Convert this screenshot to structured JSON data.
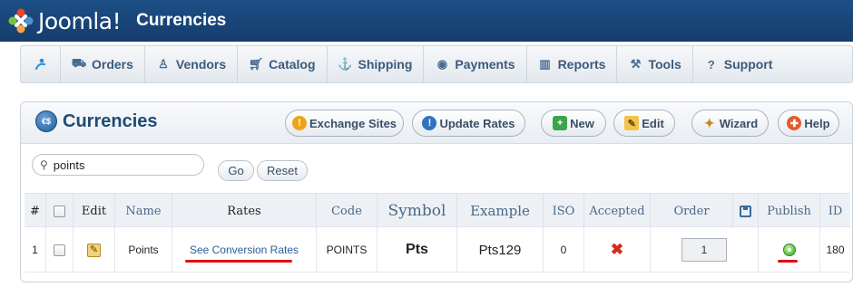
{
  "header": {
    "logo_text": "Joomla!",
    "title": "Currencies"
  },
  "menu": {
    "items": [
      {
        "label": "Orders",
        "icon": "truck-icon"
      },
      {
        "label": "Vendors",
        "icon": "person-icon"
      },
      {
        "label": "Catalog",
        "icon": "cart-icon"
      },
      {
        "label": "Shipping",
        "icon": "ship-icon"
      },
      {
        "label": "Payments",
        "icon": "coin-icon"
      },
      {
        "label": "Reports",
        "icon": "chart-icon"
      },
      {
        "label": "Tools",
        "icon": "tools-icon"
      },
      {
        "label": "Support",
        "icon": "question-icon"
      }
    ]
  },
  "toolbar": {
    "title": "Currencies",
    "title_icon_text": "€$",
    "exchange_sites": "Exchange Sites",
    "update_rates": "Update Rates",
    "new": "New",
    "edit": "Edit",
    "wizard": "Wizard",
    "help": "Help"
  },
  "filter": {
    "search_value": "points",
    "go": "Go",
    "reset": "Reset"
  },
  "table": {
    "headers": {
      "num": "#",
      "edit": "Edit",
      "name": "Name",
      "rates": "Rates",
      "code": "Code",
      "symbol": "Symbol",
      "example": "Example",
      "iso": "ISO",
      "accepted": "Accepted",
      "order": "Order",
      "publish": "Publish",
      "id": "ID"
    },
    "rows": [
      {
        "num": "1",
        "name": "Points",
        "rates": "See Conversion Rates",
        "code": "POINTS",
        "symbol": "Pts",
        "example": "Pts129",
        "iso": "0",
        "accepted": "✖",
        "order": "1",
        "id": "180"
      }
    ]
  },
  "colors": {
    "header_bg": "#1d4f86",
    "link": "#2a5d99",
    "annotation": "#e01010",
    "reject": "#d9281c",
    "publish": "#38a21f"
  }
}
